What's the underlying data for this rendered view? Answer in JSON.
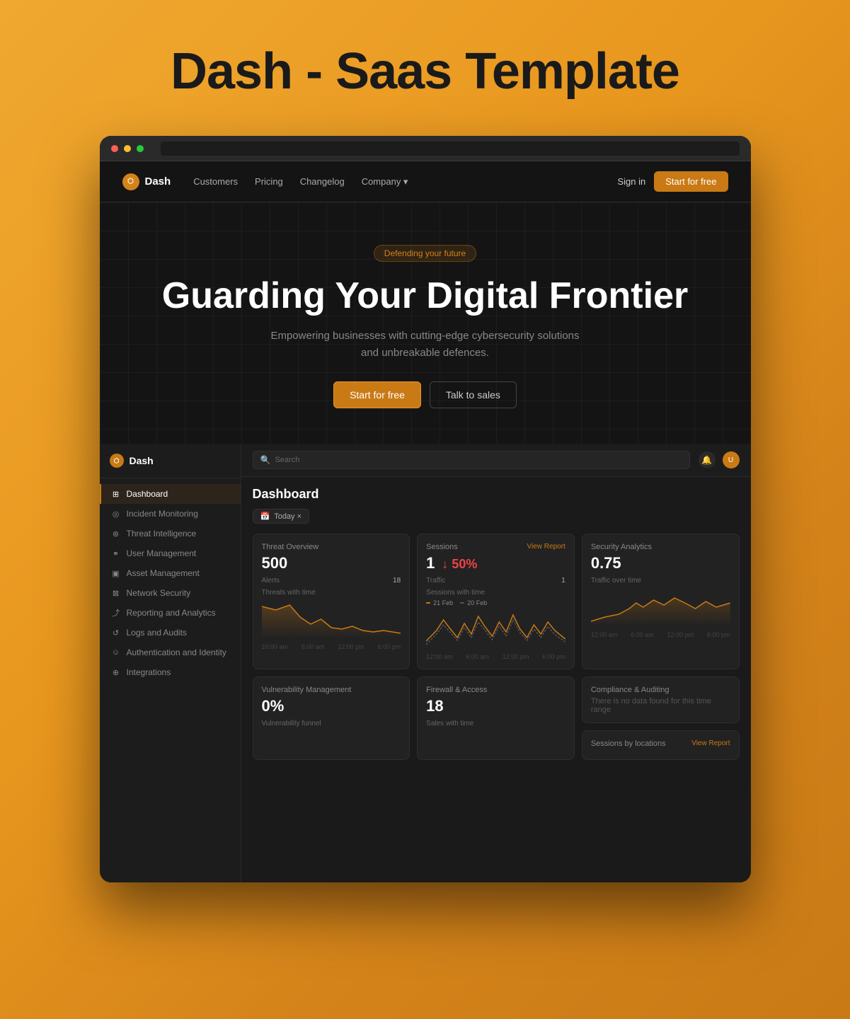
{
  "page": {
    "title": "Dash - Saas Template"
  },
  "navbar": {
    "logo": "Dash",
    "logo_icon": "⬡",
    "links": [
      "Customers",
      "Pricing",
      "Changelog",
      "Company ▾"
    ],
    "signin_label": "Sign in",
    "start_label": "Start for free"
  },
  "hero": {
    "badge": "Defending your future",
    "title": "Guarding Your Digital Frontier",
    "subtitle": "Empowering businesses with cutting-edge cybersecurity solutions and unbreakable defences.",
    "btn_start": "Start for free",
    "btn_talk": "Talk to sales"
  },
  "dashboard": {
    "title": "Dashboard",
    "filter": "Today ×",
    "logo": "Dash",
    "logo_icon": "⬡",
    "search_placeholder": "Search",
    "sidebar_items": [
      {
        "label": "Dashboard",
        "icon": "⊞",
        "active": true
      },
      {
        "label": "Incident Monitoring",
        "icon": "◎",
        "active": false
      },
      {
        "label": "Threat Intelligence",
        "icon": "⊛",
        "active": false
      },
      {
        "label": "User Management",
        "icon": "⚭",
        "active": false
      },
      {
        "label": "Asset Management",
        "icon": "▣",
        "active": false
      },
      {
        "label": "Network Security",
        "icon": "⊠",
        "active": false
      },
      {
        "label": "Reporting and Analytics",
        "icon": "⤴",
        "active": false
      },
      {
        "label": "Logs and Audits",
        "icon": "↺",
        "active": false
      },
      {
        "label": "Authentication and Identity",
        "icon": "☺",
        "active": false
      },
      {
        "label": "Integrations",
        "icon": "⊕",
        "active": false
      }
    ],
    "cards": {
      "threat_overview": {
        "title": "Threat Overview",
        "value": "500",
        "alerts_label": "Alerts",
        "alerts_value": "18",
        "chart_label": "Threats with time"
      },
      "sessions": {
        "title": "Sessions",
        "value": "1",
        "change": "↓ 50%",
        "traffic_label": "Traffic",
        "traffic_value": "1",
        "chart_label": "Sessions with time",
        "view_report": "View Report",
        "legend_1": "21 Feb",
        "legend_2": "20 Feb"
      },
      "security_analytics": {
        "title": "Security Analytics",
        "value": "0.75",
        "chart_label": "Traffic over time"
      },
      "vulnerability": {
        "title": "Vulnerability Management",
        "value": "0%",
        "chart_label": "Vulnerability funnel"
      },
      "firewall": {
        "title": "Firewall & Access",
        "value": "18",
        "chart_label": "Sales with time"
      },
      "compliance": {
        "title": "Compliance & Auditing",
        "no_data": "There is no data found for this time range"
      },
      "sessions_locations": {
        "title": "Sessions by locations",
        "view_report": "View Report"
      }
    }
  }
}
